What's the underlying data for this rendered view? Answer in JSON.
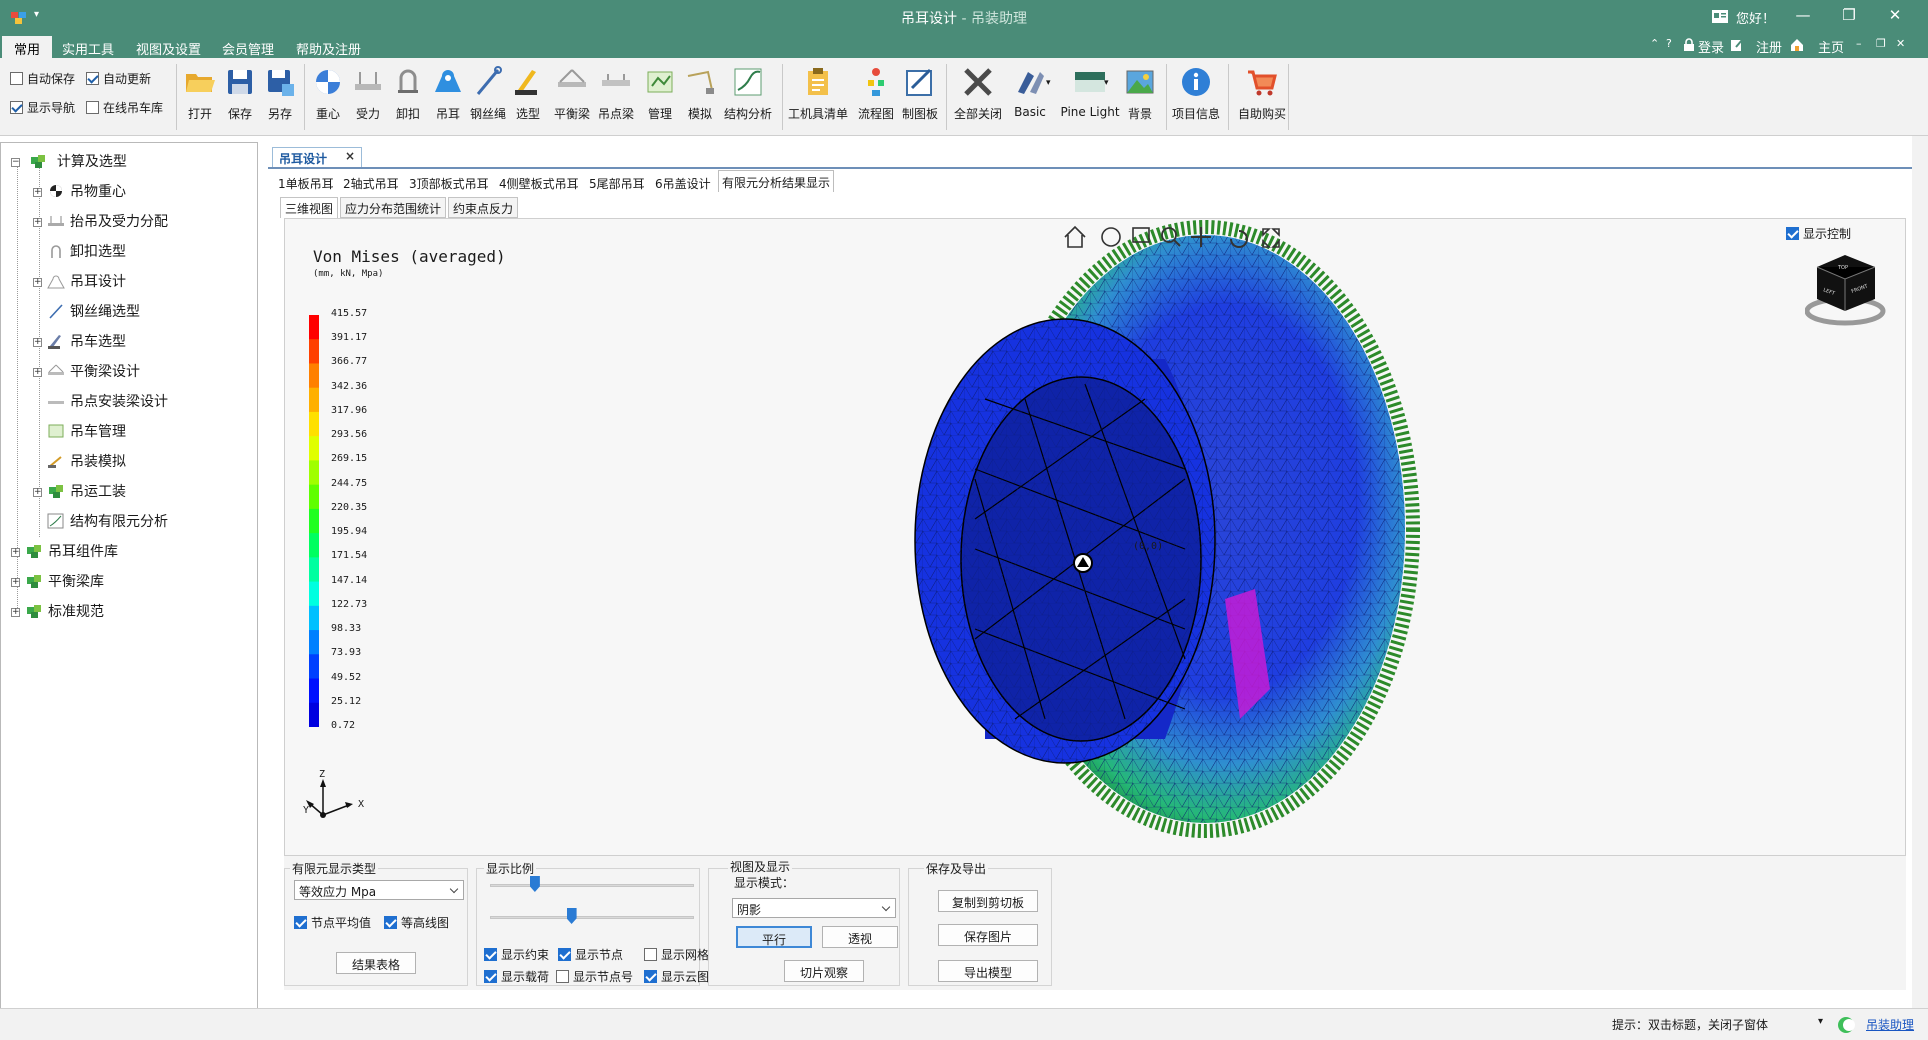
{
  "window": {
    "title": "吊耳设计",
    "subtitle": " - 吊装助理",
    "greeting": "您好！",
    "min": "—",
    "max": "❐",
    "close": "✕"
  },
  "menu": {
    "tabs": [
      "常用",
      "实用工具",
      "视图及设置",
      "会员管理",
      "帮助及注册"
    ],
    "active": 0,
    "right": {
      "login": "登录",
      "register": "注册",
      "home": "主页"
    }
  },
  "ribbon": {
    "checks": [
      {
        "label": "自动保存",
        "checked": false
      },
      {
        "label": "自动更新",
        "checked": true
      },
      {
        "label": "显示导航",
        "checked": true
      },
      {
        "label": "在线吊车库",
        "checked": false
      }
    ],
    "buttons": [
      {
        "label": "打开",
        "icon": "folder-open-icon"
      },
      {
        "label": "保存",
        "icon": "save-icon"
      },
      {
        "label": "另存",
        "icon": "save-as-icon"
      },
      {
        "label": "重心",
        "icon": "center-of-gravity-icon"
      },
      {
        "label": "受力",
        "icon": "force-icon"
      },
      {
        "label": "卸扣",
        "icon": "shackle-icon"
      },
      {
        "label": "吊耳",
        "icon": "lifting-lug-icon"
      },
      {
        "label": "钢丝绳",
        "icon": "wire-rope-icon"
      },
      {
        "label": "选型",
        "icon": "crane-selection-icon"
      },
      {
        "label": "平衡梁",
        "icon": "spreader-beam-icon"
      },
      {
        "label": "吊点梁",
        "icon": "lifting-beam-icon"
      },
      {
        "label": "管理",
        "icon": "management-icon"
      },
      {
        "label": "模拟",
        "icon": "simulation-icon"
      },
      {
        "label": "结构分析",
        "icon": "structure-analysis-icon"
      },
      {
        "label": "工机具清单",
        "icon": "clipboard-icon"
      },
      {
        "label": "流程图",
        "icon": "flowchart-icon"
      },
      {
        "label": "制图板",
        "icon": "drawing-board-icon"
      },
      {
        "label": "全部关闭",
        "icon": "close-all-icon"
      },
      {
        "label": "Basic",
        "icon": "theme-basic-icon"
      },
      {
        "label": "Pine Light",
        "icon": "theme-pine-light-icon"
      },
      {
        "label": "背景",
        "icon": "background-icon"
      },
      {
        "label": "项目信息",
        "icon": "info-icon"
      },
      {
        "label": "自助购买",
        "icon": "cart-icon"
      }
    ]
  },
  "tree": {
    "root": "计算及选型",
    "children": [
      "吊物重心",
      "抬吊及受力分配",
      "卸扣选型",
      "吊耳设计",
      "钢丝绳选型",
      "吊车选型",
      "平衡梁设计",
      "吊点安装梁设计",
      "吊车管理",
      "吊装模拟",
      "吊运工装",
      "结构有限元分析"
    ],
    "others": [
      "吊耳组件库",
      "平衡梁库",
      "标准规范"
    ]
  },
  "document": {
    "tab": "吊耳设计",
    "close": "×",
    "subtabs": [
      "1单板吊耳",
      "2轴式吊耳",
      "3顶部板式吊耳",
      "4侧壁板式吊耳",
      "5尾部吊耳",
      "6吊盖设计",
      "有限元分析结果显示"
    ],
    "active_subtab": 6,
    "inner_tabs": [
      "三维视图",
      "应力分布范围统计",
      "约束点反力"
    ],
    "active_inner": 0
  },
  "viewer": {
    "title": "Von Mises (averaged)",
    "units": "(mm, kN, Mpa)",
    "show_control": "显示控制",
    "legend": [
      "415.57",
      "391.17",
      "366.77",
      "342.36",
      "317.96",
      "293.56",
      "269.15",
      "244.75",
      "220.35",
      "195.94",
      "171.54",
      "147.14",
      "122.73",
      "98.33",
      "73.93",
      "49.52",
      "25.12",
      "0.72"
    ],
    "legend_colors": [
      "#ff0000",
      "#ff4000",
      "#ff8000",
      "#ffb000",
      "#ffe000",
      "#e0ff00",
      "#a0ff00",
      "#60ff00",
      "#20ff20",
      "#00ff60",
      "#00ffa0",
      "#00ffe0",
      "#00c0ff",
      "#0080ff",
      "#0040ff",
      "#0010ff",
      "#0000e0"
    ],
    "axes": {
      "x": "X",
      "y": "Y",
      "z": "Z"
    },
    "origin_label": "(0,0)",
    "view_cube": {
      "top": "TOP",
      "front": "FRONT",
      "left": "LEFT"
    }
  },
  "controls": {
    "display_type": {
      "title": "有限元显示类型",
      "select": "等效应力 Mpa",
      "node_avg": "节点平均值",
      "contour": "等高线图",
      "result_table": "结果表格"
    },
    "scale": {
      "title": "显示比例",
      "slider1": 0.22,
      "slider2": 0.4,
      "checks": [
        {
          "label": "显示约束",
          "checked": true
        },
        {
          "label": "显示节点",
          "checked": true
        },
        {
          "label": "显示网格",
          "checked": false
        },
        {
          "label": "显示载荷",
          "checked": true
        },
        {
          "label": "显示节点号",
          "checked": false
        },
        {
          "label": "显示云图",
          "checked": true
        }
      ]
    },
    "view": {
      "title": "视图及显示",
      "mode_label": "显示模式：",
      "mode": "阴影",
      "parallel": "平行",
      "perspective": "透视",
      "slice": "切片观察"
    },
    "export": {
      "title": "保存及导出",
      "copy": "复制到剪切板",
      "save_image": "保存图片",
      "export_model": "导出模型"
    }
  },
  "status": {
    "hint": "提示：双击标题，关闭子窗体",
    "link": "吊装助理"
  }
}
